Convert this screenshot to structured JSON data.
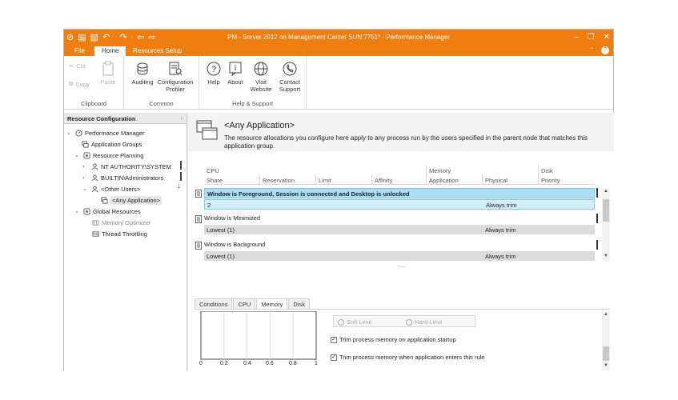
{
  "window": {
    "title": "PM - Server 2012 on Management Center SUN:7751* - Performance Manager"
  },
  "tabs": [
    {
      "label": "File"
    },
    {
      "label": "Home"
    },
    {
      "label": "Resources Setup"
    }
  ],
  "ribbon": {
    "clipboard": {
      "label": "Clipboard",
      "cut": "Cut",
      "copy": "Copy",
      "paste": "Paste"
    },
    "common": {
      "label": "Common",
      "auditing": "Auditing",
      "config_profiler": "Configuration Profiler"
    },
    "help_support": {
      "label": "Help & Support",
      "help": "Help",
      "about": "About",
      "visit_website": "Visit Website",
      "contact_support": "Contact Support"
    }
  },
  "left_pane": {
    "header": "Resource Configuration",
    "tree": [
      {
        "label": "Performance Manager"
      },
      {
        "label": "Application Groups"
      },
      {
        "label": "Resource Planning"
      },
      {
        "label": "NT AUTHORITY\\SYSTEM"
      },
      {
        "label": "BUILTIN\\Administrators"
      },
      {
        "label": "<Other Users>"
      },
      {
        "label": "<Any Application>"
      },
      {
        "label": "Global Resources"
      },
      {
        "label": "Memory Optimizer"
      },
      {
        "label": "Thread Throttling"
      }
    ]
  },
  "main": {
    "title": "<Any Application>",
    "description": "The resource allocations you configure here apply to any process run by the users specified in the parent node that matches this application group.",
    "grid": {
      "groups": [
        "CPU",
        "Memory",
        "Disk"
      ],
      "columns": [
        "Share",
        "Reservation",
        "Limit",
        "Affinity",
        "Application",
        "Physical",
        "Priority"
      ],
      "rules": [
        {
          "title": "Window is Foreground, Session is connected and Desktop is unlocked",
          "share": "2",
          "physical": "Always trim"
        },
        {
          "title": "Window is Minimized",
          "share": "Lowest (1)",
          "physical": "Always trim"
        },
        {
          "title": "Window is Background",
          "share": "Lowest (1)",
          "physical": "Always trim"
        }
      ],
      "more": "...."
    },
    "bottom_tabs": [
      "Conditions",
      "CPU",
      "Memory",
      "Disk"
    ],
    "memory_panel": {
      "soft_limit": "Soft Limit",
      "hard_limit": "Hard Limit",
      "trim_startup": "Trim process memory on application startup",
      "trim_rule": "Trim process memory when application enters this rule",
      "chart_ticks": [
        "0",
        "0.2",
        "0.4",
        "0.6",
        "0.8",
        "1"
      ]
    }
  },
  "colors": {
    "accent": "#ef7d10",
    "highlight_row": "#a9def5",
    "highlight_row_light": "#d3eefa"
  }
}
